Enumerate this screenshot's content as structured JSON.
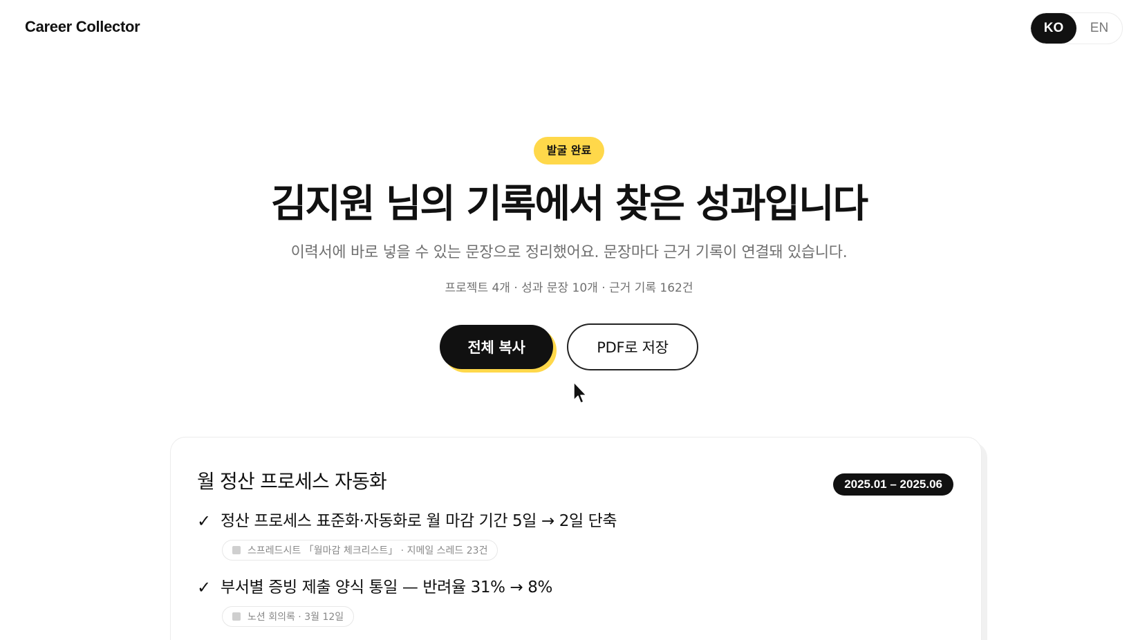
{
  "header": {
    "brand": "Career Collector",
    "languages": [
      {
        "label": "KO",
        "active": true
      },
      {
        "label": "EN",
        "active": false
      }
    ]
  },
  "hero": {
    "badge": "발굴 완료",
    "title": "김지원 님의 기록에서 찾은 성과입니다",
    "subtitle": "이력서에 바로 넣을 수 있는 문장으로 정리했어요. 문장마다 근거 기록이 연결돼 있습니다.",
    "stats": "프로젝트 4개 · 성과 문장 10개 · 근거 기록 162건",
    "copy_all_label": "전체 복사",
    "save_pdf_label": "PDF로 저장"
  },
  "project": {
    "title": "월 정산 프로세스 자동화",
    "period": "2025.01 – 2025.06",
    "achievements": [
      {
        "text": "정산 프로세스 표준화·자동화로 월 마감 기간 5일 → 2일 단축",
        "evidence": "스프레드시트 「월마감 체크리스트」 · 지메일 스레드 23건"
      },
      {
        "text": "부서별 증빙 제출 양식 통일 — 반려율 31% → 8%",
        "evidence": "노션 회의록 · 3월 12일"
      }
    ]
  },
  "colors": {
    "accent": "#ffd84a",
    "ink": "#111111",
    "muted": "#707070"
  },
  "icons": [
    "check-icon",
    "document-icon",
    "mouse-cursor-icon"
  ]
}
